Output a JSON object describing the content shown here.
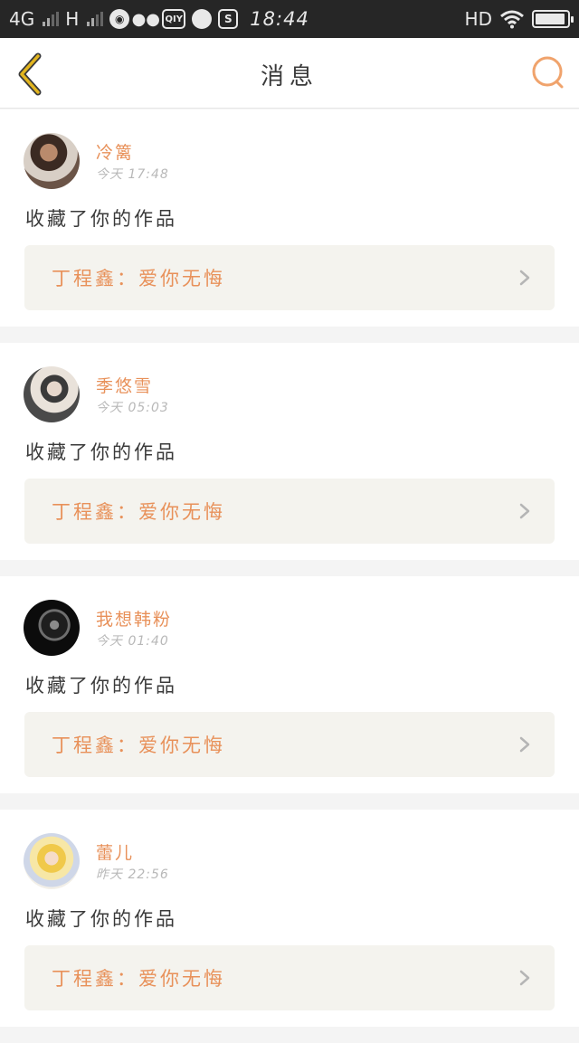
{
  "status_bar": {
    "network": "4G",
    "network2": "H",
    "app_icons": [
      "browser-icon",
      "wechat-icon",
      "iqiyi-icon",
      "message-icon",
      "s-app-icon"
    ],
    "iqiyi_label": "QIY",
    "s_label": "S",
    "time": "18:44",
    "hd": "HD",
    "battery_level": 0.95
  },
  "header": {
    "title": "消息"
  },
  "messages": [
    {
      "username": "冷篱",
      "time": "今天  17:48",
      "action": "收藏了你的作品",
      "work": "丁程鑫：爱你无悔"
    },
    {
      "username": "季悠雪",
      "time": "今天  05:03",
      "action": "收藏了你的作品",
      "work": "丁程鑫：爱你无悔"
    },
    {
      "username": "我想韩粉",
      "time": "今天  01:40",
      "action": "收藏了你的作品",
      "work": "丁程鑫：爱你无悔"
    },
    {
      "username": "蕾儿",
      "time": "昨天  22:56",
      "action": "收藏了你的作品",
      "work": "丁程鑫：爱你无悔"
    }
  ],
  "colors": {
    "accent": "#e8915a",
    "back_arrow": "#e2b51f",
    "work_bg": "#f4f3ee",
    "status_bar_bg": "#262626"
  }
}
